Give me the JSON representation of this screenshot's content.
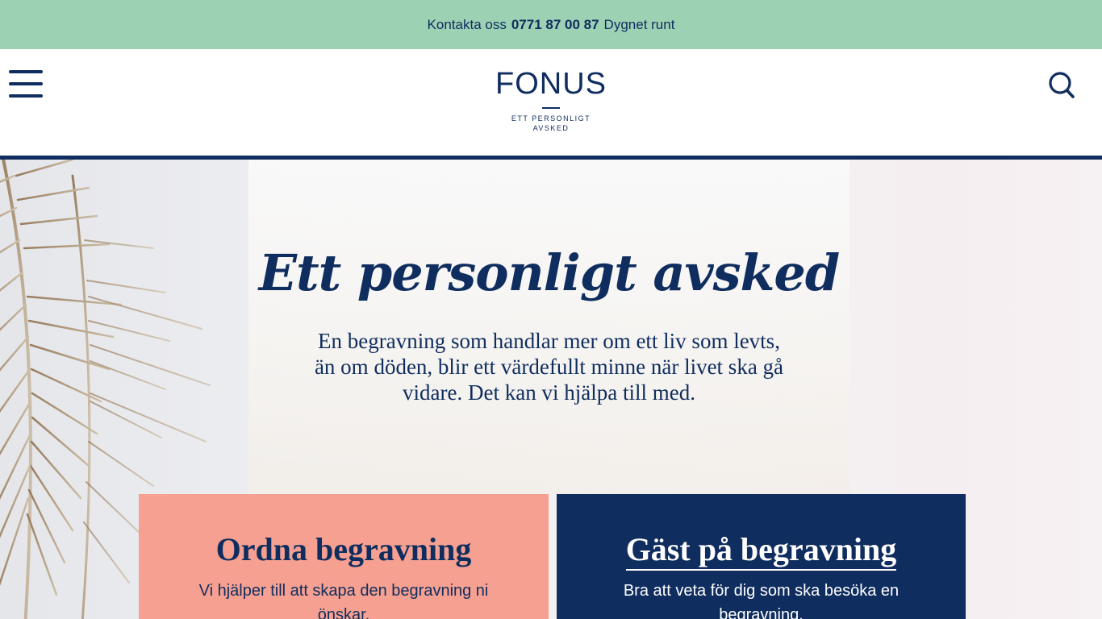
{
  "topbar": {
    "contact_label": "Kontakta oss",
    "phone": "0771 87 00 87",
    "hours": "Dygnet runt"
  },
  "header": {
    "menu_icon": "hamburger-menu-icon",
    "search_icon": "search-icon",
    "logo": {
      "wordmark": "FONUS",
      "tagline_line1": "ETT PERSONLIGT",
      "tagline_line2": "AVSKED"
    }
  },
  "hero": {
    "title": "Ett personligt avsked",
    "text": "En begravning som handlar mer om ett liv som levts, än om döden, blir ett värdefullt minne när livet ska gå vidare. Det kan vi hjälpa till med."
  },
  "cards": [
    {
      "title": "Ordna begravning",
      "text": "Vi hjälper till att skapa den begravning ni önskar.",
      "background": "#f5a091"
    },
    {
      "title": "Gäst på begravning",
      "text": "Bra att veta för dig som ska besöka en begravning.",
      "background": "#0f2d5e"
    }
  ],
  "colors": {
    "topbar": "#9dd1b3",
    "navy": "#0f2d5e",
    "salmon": "#f5a091"
  }
}
